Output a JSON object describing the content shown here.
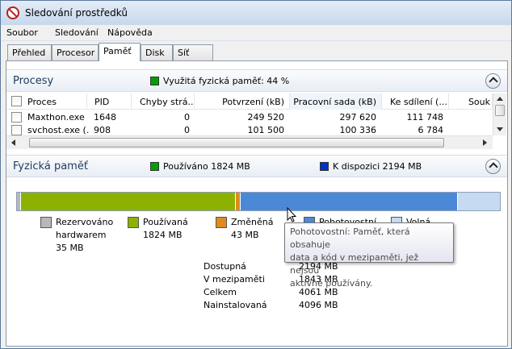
{
  "window": {
    "title": "Sledování prostředků"
  },
  "menu": [
    "Soubor",
    "Sledování",
    "Nápověda"
  ],
  "tabs": [
    "Přehled",
    "Procesor",
    "Paměť",
    "Disk",
    "Síť"
  ],
  "active_tab": "Paměť",
  "processes": {
    "title": "Procesy",
    "summary": "Využitá fyzická paměť: 44 %",
    "summary_color": "#00a000",
    "columns": [
      "Proces",
      "PID",
      "Chyby strá...",
      "Potvrzení (kB)",
      "Pracovní sada (kB)",
      "Ke sdílení (...",
      "Souk"
    ],
    "sorted_column": "Pracovní sada (kB)",
    "rows": [
      [
        "Maxthon.exe",
        "1648",
        "0",
        "249 520",
        "297 620",
        "111 748"
      ],
      [
        "svchost.exe (...",
        "908",
        "0",
        "101 500",
        "100 336",
        "6 784"
      ]
    ]
  },
  "physical_memory": {
    "title": "Fyzická paměť",
    "in_use_header": "Používáno 1824 MB",
    "available_header": "K dispozici 2194 MB",
    "in_use_color": "#00a000",
    "available_color": "#0033cc",
    "bar": {
      "total_mb": 4096,
      "segments": [
        {
          "name": "reserved",
          "mb": 35,
          "color": "#b8b8b8"
        },
        {
          "name": "in-use",
          "mb": 1824,
          "color": "#8db100"
        },
        {
          "name": "modified",
          "mb": 43,
          "color": "#e08a1e"
        },
        {
          "name": "standby",
          "mb": 1843,
          "color": "#4b89d6"
        },
        {
          "name": "free",
          "mb": 351,
          "color": "#c6daf1"
        }
      ]
    },
    "legend": [
      {
        "line1": "Rezervováno",
        "line2": "hardwarem",
        "line3": "35 MB",
        "color": "#b8b8b8"
      },
      {
        "line1": "Používaná",
        "line2": "1824 MB",
        "color": "#8db100"
      },
      {
        "line1": "Změněná",
        "line2": "43 MB",
        "color": "#e08a1e"
      },
      {
        "line1": "Pohotovostní",
        "color": "#4b89d6"
      },
      {
        "line1": "Volná",
        "color": "#c6daf1"
      }
    ],
    "stats": [
      {
        "label": "Dostupná",
        "value": "2194 MB"
      },
      {
        "label": "V mezipaměti",
        "value": "1843 MB"
      },
      {
        "label": "Celkem",
        "value": "4061 MB"
      },
      {
        "label": "Nainstalovaná",
        "value": "4096 MB"
      }
    ]
  },
  "tooltip": {
    "line1": "Pohotovostní: Paměť, která obsahuje",
    "line2": "data a kód v mezipaměti, jež nejsou",
    "line3": "aktivně používány."
  }
}
